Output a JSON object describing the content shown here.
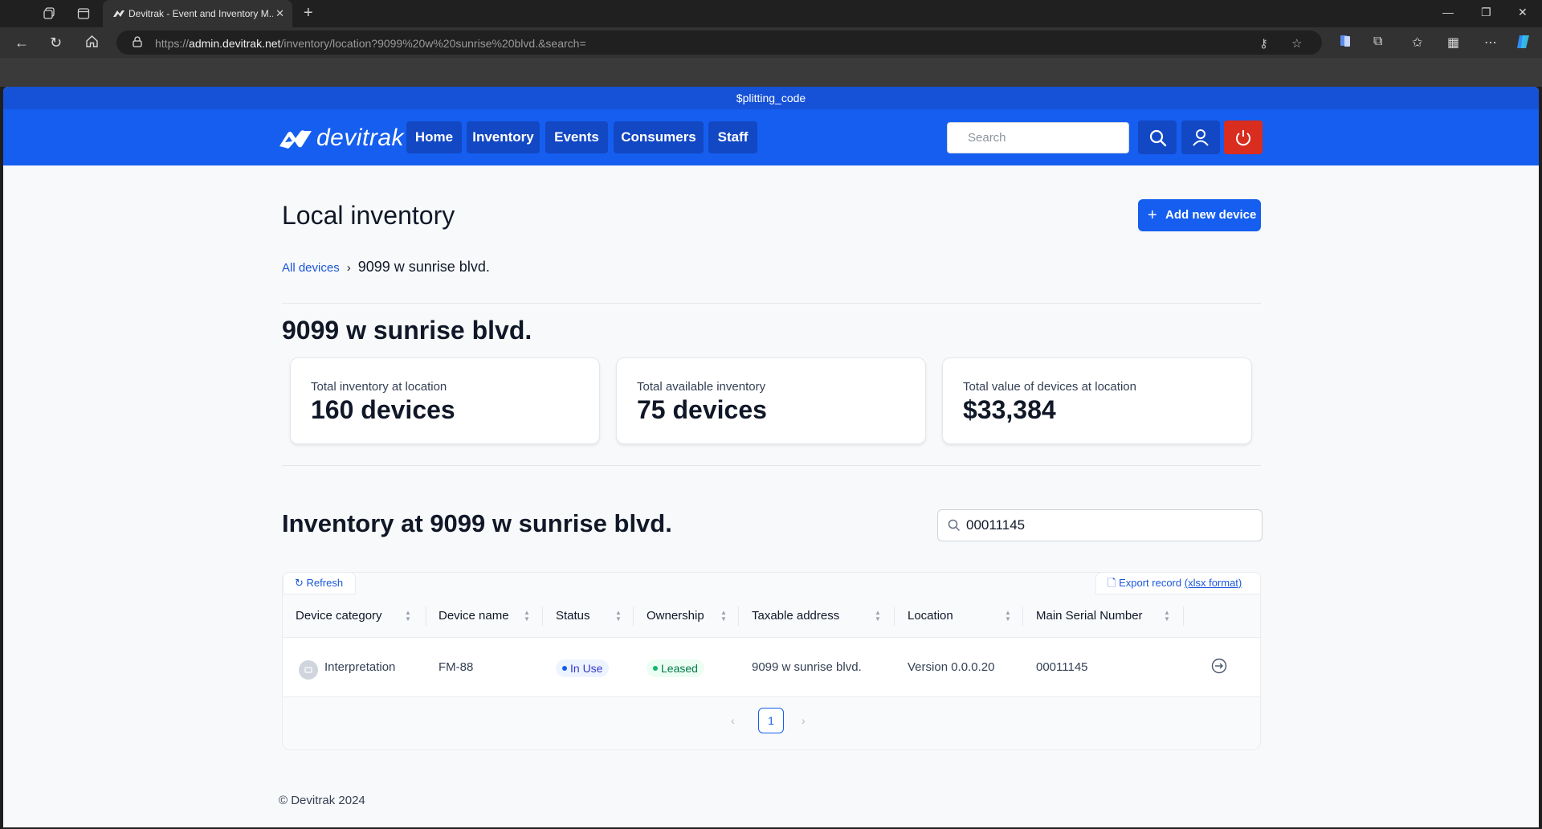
{
  "browser": {
    "tab_title": "Devitrak - Event and Inventory M...",
    "url_scheme": "https://",
    "url_host": "admin.devitrak.net",
    "url_path": "/inventory/location?9099%20w%20sunrise%20blvd.&search="
  },
  "app": {
    "top_strip_text": "$plitting_code",
    "logo_text": "devitrak",
    "nav": [
      "Home",
      "Inventory",
      "Events",
      "Consumers",
      "Staff"
    ],
    "search_placeholder": "Search",
    "brand_color": "#155eef",
    "logout_color": "#d92d20"
  },
  "page": {
    "title": "Local inventory",
    "add_button_label": "Add new device",
    "breadcrumb_root": "All devices",
    "breadcrumb_current": "9099 w sunrise blvd.",
    "location_heading": "9099 w sunrise blvd.",
    "stats": [
      {
        "label": "Total inventory at location",
        "value": "160 devices"
      },
      {
        "label": "Total available inventory",
        "value": "75 devices"
      },
      {
        "label": "Total value of devices at location",
        "value": "$33,384"
      }
    ],
    "table_heading": "Inventory at 9099 w sunrise blvd.",
    "table_search_value": "00011145"
  },
  "table": {
    "refresh_label": "Refresh",
    "export_label": "Export record",
    "export_format": "(xlsx format)",
    "columns": [
      "Device category",
      "Device name",
      "Status",
      "Ownership",
      "Taxable address",
      "Location",
      "Main Serial Number"
    ],
    "rows": [
      {
        "category": "Interpretation",
        "device_name": "FM-88",
        "status": "In Use",
        "ownership": "Leased",
        "taxable_address": "9099 w sunrise blvd.",
        "location": "Version 0.0.0.20",
        "serial": "00011145"
      }
    ],
    "current_page": "1"
  },
  "footer": {
    "text": "© Devitrak 2024"
  }
}
